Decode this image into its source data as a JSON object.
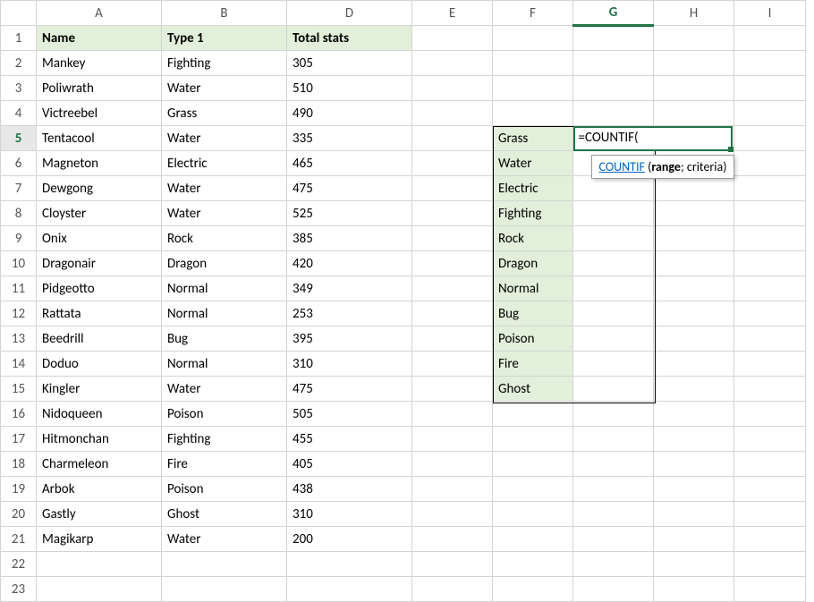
{
  "columns": [
    "A",
    "B",
    "D",
    "E",
    "F",
    "G",
    "H",
    "I"
  ],
  "rowCount": 23,
  "activeCol": "G",
  "activeRow": 5,
  "headers": {
    "A": "Name",
    "B": "Type 1",
    "D": "Total stats"
  },
  "mainRows": [
    {
      "name": "Mankey",
      "type": "Fighting",
      "total": "305"
    },
    {
      "name": "Poliwrath",
      "type": "Water",
      "total": "510"
    },
    {
      "name": "Victreebel",
      "type": "Grass",
      "total": "490"
    },
    {
      "name": "Tentacool",
      "type": "Water",
      "total": "335"
    },
    {
      "name": "Magneton",
      "type": "Electric",
      "total": "465"
    },
    {
      "name": "Dewgong",
      "type": "Water",
      "total": "475"
    },
    {
      "name": "Cloyster",
      "type": "Water",
      "total": "525"
    },
    {
      "name": "Onix",
      "type": "Rock",
      "total": "385"
    },
    {
      "name": "Dragonair",
      "type": "Dragon",
      "total": "420"
    },
    {
      "name": "Pidgeotto",
      "type": "Normal",
      "total": "349"
    },
    {
      "name": "Rattata",
      "type": "Normal",
      "total": "253"
    },
    {
      "name": "Beedrill",
      "type": "Bug",
      "total": "395"
    },
    {
      "name": "Doduo",
      "type": "Normal",
      "total": "310"
    },
    {
      "name": "Kingler",
      "type": "Water",
      "total": "475"
    },
    {
      "name": "Nidoqueen",
      "type": "Poison",
      "total": "505"
    },
    {
      "name": "Hitmonchan",
      "type": "Fighting",
      "total": "455"
    },
    {
      "name": "Charmeleon",
      "type": "Fire",
      "total": "405"
    },
    {
      "name": "Arbok",
      "type": "Poison",
      "total": "438"
    },
    {
      "name": "Gastly",
      "type": "Ghost",
      "total": "310"
    },
    {
      "name": "Magikarp",
      "type": "Water",
      "total": "200"
    }
  ],
  "typesList": [
    "Grass",
    "Water",
    "Electric",
    "Fighting",
    "Rock",
    "Dragon",
    "Normal",
    "Bug",
    "Poison",
    "Fire",
    "Ghost"
  ],
  "typesStartRow": 5,
  "formulaCell": {
    "col": "G",
    "row": 5,
    "text": "=COUNTIF("
  },
  "tooltip": {
    "fn": "COUNTIF",
    "open": " (",
    "arg1": "range",
    "sep": "; ",
    "arg2": "criteria",
    "close": ")"
  }
}
